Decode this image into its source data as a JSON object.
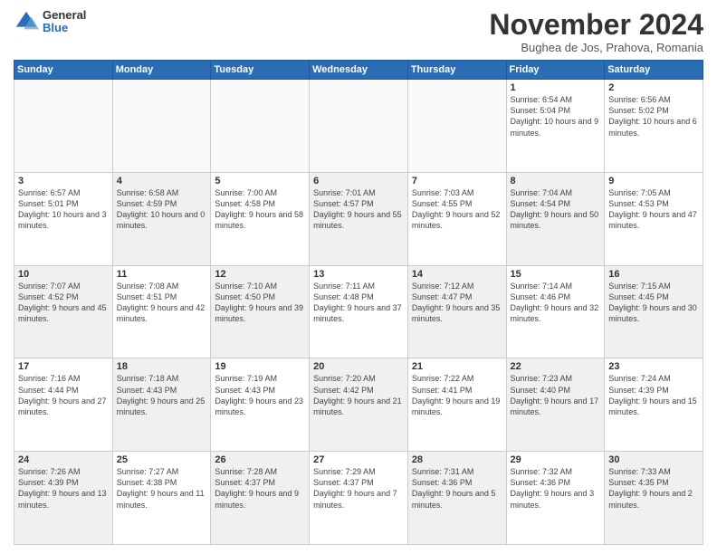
{
  "header": {
    "logo_general": "General",
    "logo_blue": "Blue",
    "month": "November 2024",
    "location": "Bughea de Jos, Prahova, Romania"
  },
  "days_of_week": [
    "Sunday",
    "Monday",
    "Tuesday",
    "Wednesday",
    "Thursday",
    "Friday",
    "Saturday"
  ],
  "weeks": [
    [
      {
        "day": "",
        "info": ""
      },
      {
        "day": "",
        "info": ""
      },
      {
        "day": "",
        "info": ""
      },
      {
        "day": "",
        "info": ""
      },
      {
        "day": "",
        "info": ""
      },
      {
        "day": "1",
        "info": "Sunrise: 6:54 AM\nSunset: 5:04 PM\nDaylight: 10 hours and 9 minutes."
      },
      {
        "day": "2",
        "info": "Sunrise: 6:56 AM\nSunset: 5:02 PM\nDaylight: 10 hours and 6 minutes."
      }
    ],
    [
      {
        "day": "3",
        "info": "Sunrise: 6:57 AM\nSunset: 5:01 PM\nDaylight: 10 hours and 3 minutes."
      },
      {
        "day": "4",
        "info": "Sunrise: 6:58 AM\nSunset: 4:59 PM\nDaylight: 10 hours and 0 minutes."
      },
      {
        "day": "5",
        "info": "Sunrise: 7:00 AM\nSunset: 4:58 PM\nDaylight: 9 hours and 58 minutes."
      },
      {
        "day": "6",
        "info": "Sunrise: 7:01 AM\nSunset: 4:57 PM\nDaylight: 9 hours and 55 minutes."
      },
      {
        "day": "7",
        "info": "Sunrise: 7:03 AM\nSunset: 4:55 PM\nDaylight: 9 hours and 52 minutes."
      },
      {
        "day": "8",
        "info": "Sunrise: 7:04 AM\nSunset: 4:54 PM\nDaylight: 9 hours and 50 minutes."
      },
      {
        "day": "9",
        "info": "Sunrise: 7:05 AM\nSunset: 4:53 PM\nDaylight: 9 hours and 47 minutes."
      }
    ],
    [
      {
        "day": "10",
        "info": "Sunrise: 7:07 AM\nSunset: 4:52 PM\nDaylight: 9 hours and 45 minutes."
      },
      {
        "day": "11",
        "info": "Sunrise: 7:08 AM\nSunset: 4:51 PM\nDaylight: 9 hours and 42 minutes."
      },
      {
        "day": "12",
        "info": "Sunrise: 7:10 AM\nSunset: 4:50 PM\nDaylight: 9 hours and 39 minutes."
      },
      {
        "day": "13",
        "info": "Sunrise: 7:11 AM\nSunset: 4:48 PM\nDaylight: 9 hours and 37 minutes."
      },
      {
        "day": "14",
        "info": "Sunrise: 7:12 AM\nSunset: 4:47 PM\nDaylight: 9 hours and 35 minutes."
      },
      {
        "day": "15",
        "info": "Sunrise: 7:14 AM\nSunset: 4:46 PM\nDaylight: 9 hours and 32 minutes."
      },
      {
        "day": "16",
        "info": "Sunrise: 7:15 AM\nSunset: 4:45 PM\nDaylight: 9 hours and 30 minutes."
      }
    ],
    [
      {
        "day": "17",
        "info": "Sunrise: 7:16 AM\nSunset: 4:44 PM\nDaylight: 9 hours and 27 minutes."
      },
      {
        "day": "18",
        "info": "Sunrise: 7:18 AM\nSunset: 4:43 PM\nDaylight: 9 hours and 25 minutes."
      },
      {
        "day": "19",
        "info": "Sunrise: 7:19 AM\nSunset: 4:43 PM\nDaylight: 9 hours and 23 minutes."
      },
      {
        "day": "20",
        "info": "Sunrise: 7:20 AM\nSunset: 4:42 PM\nDaylight: 9 hours and 21 minutes."
      },
      {
        "day": "21",
        "info": "Sunrise: 7:22 AM\nSunset: 4:41 PM\nDaylight: 9 hours and 19 minutes."
      },
      {
        "day": "22",
        "info": "Sunrise: 7:23 AM\nSunset: 4:40 PM\nDaylight: 9 hours and 17 minutes."
      },
      {
        "day": "23",
        "info": "Sunrise: 7:24 AM\nSunset: 4:39 PM\nDaylight: 9 hours and 15 minutes."
      }
    ],
    [
      {
        "day": "24",
        "info": "Sunrise: 7:26 AM\nSunset: 4:39 PM\nDaylight: 9 hours and 13 minutes."
      },
      {
        "day": "25",
        "info": "Sunrise: 7:27 AM\nSunset: 4:38 PM\nDaylight: 9 hours and 11 minutes."
      },
      {
        "day": "26",
        "info": "Sunrise: 7:28 AM\nSunset: 4:37 PM\nDaylight: 9 hours and 9 minutes."
      },
      {
        "day": "27",
        "info": "Sunrise: 7:29 AM\nSunset: 4:37 PM\nDaylight: 9 hours and 7 minutes."
      },
      {
        "day": "28",
        "info": "Sunrise: 7:31 AM\nSunset: 4:36 PM\nDaylight: 9 hours and 5 minutes."
      },
      {
        "day": "29",
        "info": "Sunrise: 7:32 AM\nSunset: 4:36 PM\nDaylight: 9 hours and 3 minutes."
      },
      {
        "day": "30",
        "info": "Sunrise: 7:33 AM\nSunset: 4:35 PM\nDaylight: 9 hours and 2 minutes."
      }
    ]
  ]
}
